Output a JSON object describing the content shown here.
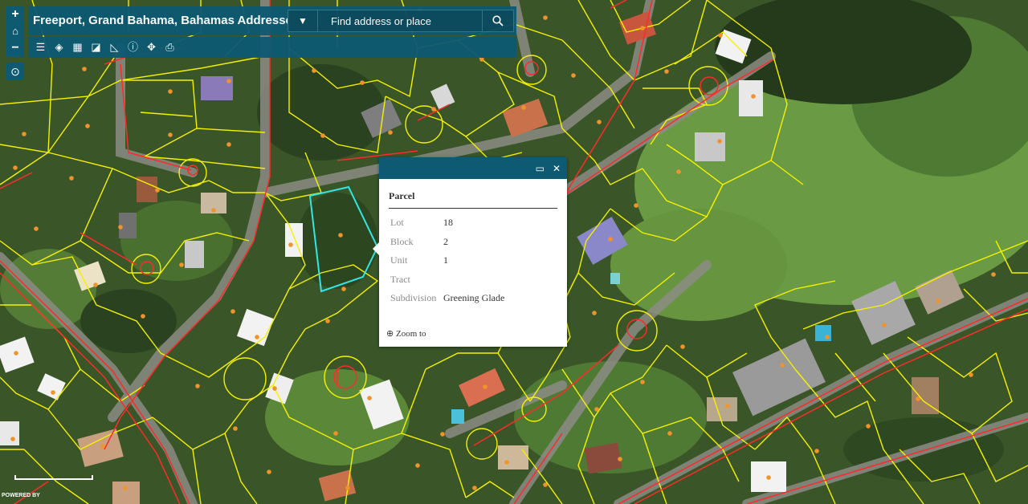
{
  "header": {
    "title": "Freeport, Grand Bahama, Bahamas Addresses",
    "search_placeholder": "Find address or place"
  },
  "zoom": {
    "in_label": "+",
    "home_label": "⌂",
    "out_label": "−"
  },
  "toolbar": {
    "tools": [
      "list-icon",
      "layers-icon",
      "basemap-icon",
      "swipe-icon",
      "measure-icon",
      "info-icon",
      "pan-icon",
      "print-icon"
    ]
  },
  "popup": {
    "title": "Parcel",
    "fields": [
      {
        "key": "Lot",
        "value": "18"
      },
      {
        "key": "Block",
        "value": "2"
      },
      {
        "key": "Unit",
        "value": "1"
      },
      {
        "key": "Tract",
        "value": ""
      },
      {
        "key": "Subdivision",
        "value": "Greening Glade"
      }
    ],
    "zoom_label": "Zoom to"
  },
  "attribution": "POWERED BY",
  "colors": {
    "panel": "#0e5a72",
    "parcel_line": "#ffff00",
    "road_line": "#ff2a2a",
    "selected": "#33e6e6",
    "marker": "#f0932b"
  }
}
